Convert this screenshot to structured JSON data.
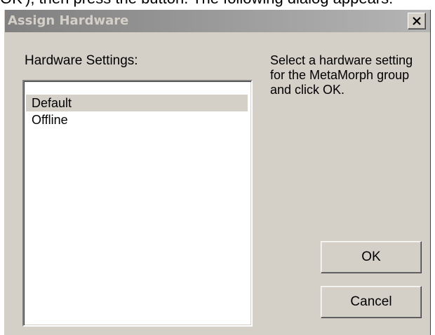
{
  "background_text": "OK'), then press the button. The following dialog appears:",
  "dialog": {
    "title": "Assign Hardware",
    "close_glyph": "✕",
    "hardware_label": "Hardware Settings:",
    "instruction": "Select a hardware setting for the MetaMorph group and click OK.",
    "list_items": [
      {
        "label": "Default",
        "selected": true
      },
      {
        "label": "Offline",
        "selected": false
      }
    ],
    "ok_label": "OK",
    "cancel_label": "Cancel"
  },
  "colors": {
    "dialog_face": "#d4d0c8",
    "title_gradient_start": "#808080",
    "title_gradient_end": "#b5b5b5",
    "title_text": "#d4d0c8"
  },
  "icons": {
    "close": "close-icon"
  }
}
